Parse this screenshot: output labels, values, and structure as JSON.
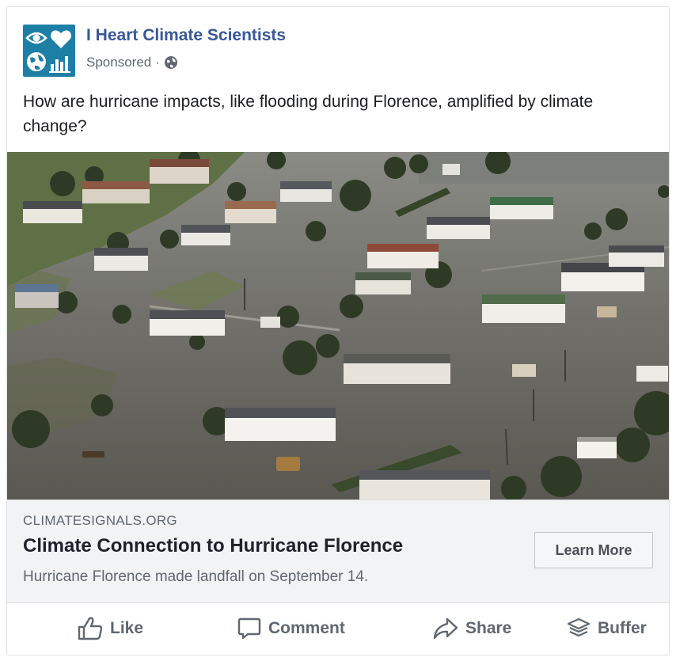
{
  "post": {
    "page_name": "I Heart Climate Scientists",
    "sponsored": "Sponsored",
    "separator": "·",
    "text": "How are hurricane impacts, like flooding during Florence, amplified by climate change?"
  },
  "link": {
    "domain": "CLIMATESIGNALS.ORG",
    "headline": "Climate Connection to Hurricane Florence",
    "description": "Hurricane Florence made landfall on September 14.",
    "cta": "Learn More"
  },
  "actions": {
    "like": "Like",
    "comment": "Comment",
    "share": "Share",
    "buffer": "Buffer"
  },
  "colors": {
    "page_name": "#385898",
    "logo_bg": "#1d7fa6",
    "flood_water": "#6f6e68"
  },
  "icons": [
    "eye-icon",
    "heart-icon",
    "globe-icon",
    "chart-icon",
    "public-globe-icon",
    "thumbs-up-icon",
    "comment-icon",
    "share-icon",
    "buffer-icon"
  ]
}
